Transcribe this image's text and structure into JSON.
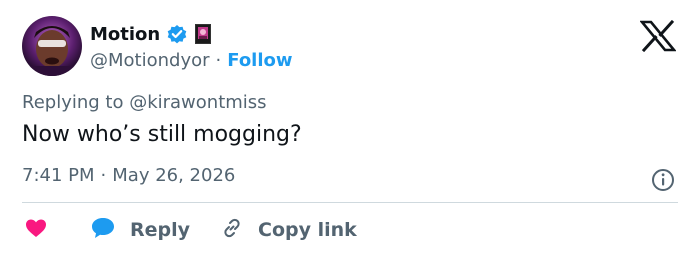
{
  "author": {
    "display_name": "Motion",
    "handle": "@Motiondyor",
    "separator": "·",
    "follow_label": "Follow"
  },
  "reply_to": "Replying to @kirawontmiss",
  "tweet": {
    "text": "Now who’s still mogging?"
  },
  "meta": {
    "time": "7:41 PM",
    "separator": "·",
    "date": "May 26, 2026"
  },
  "actions": {
    "reply_label": "Reply",
    "copy_label": "Copy link"
  },
  "colors": {
    "accent": "#1d9bf0",
    "like": "#f91880",
    "text": "#0f1419",
    "secondary": "#536471",
    "divider": "#cfd9de"
  }
}
